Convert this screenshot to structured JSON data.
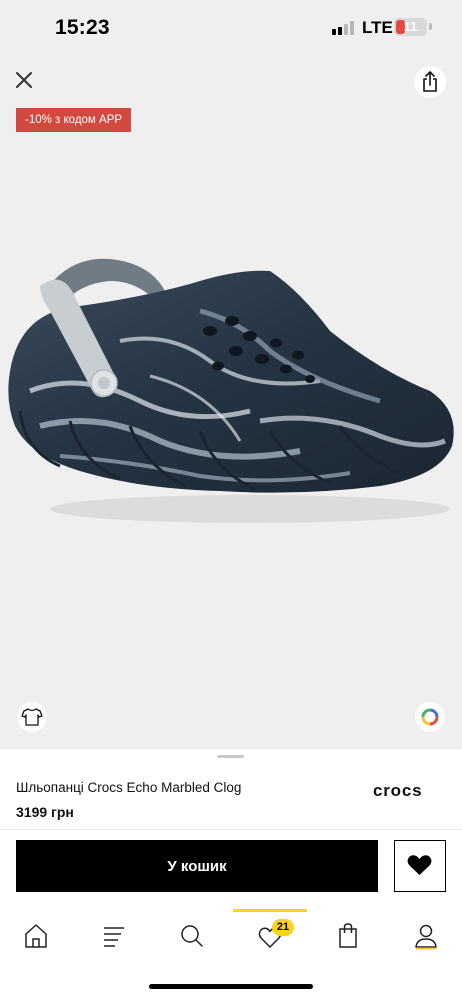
{
  "status_bar": {
    "time": "15:23",
    "network": "LTE",
    "battery": "11"
  },
  "gallery": {
    "promo_badge": "-10% з кодом APP",
    "close_icon": "close-icon",
    "share_icon": "share-icon",
    "tshirt_icon": "tshirt-icon",
    "color_icon": "color-wheel-icon"
  },
  "product": {
    "name": "Шльопанці Crocs Echo Marbled Clog",
    "price": "3199 грн",
    "brand": "crocs"
  },
  "actions": {
    "add_to_cart": "У кошик",
    "wishlist_icon": "heart-icon"
  },
  "bottom_nav": {
    "items": [
      {
        "icon": "home-icon"
      },
      {
        "icon": "menu-icon"
      },
      {
        "icon": "search-icon"
      },
      {
        "icon": "heart-icon",
        "badge": "21",
        "active": true
      },
      {
        "icon": "bag-icon"
      },
      {
        "icon": "user-icon"
      }
    ]
  },
  "colors": {
    "accent": "#ffd21f",
    "promo": "#d24a3f",
    "button": "#000000"
  }
}
